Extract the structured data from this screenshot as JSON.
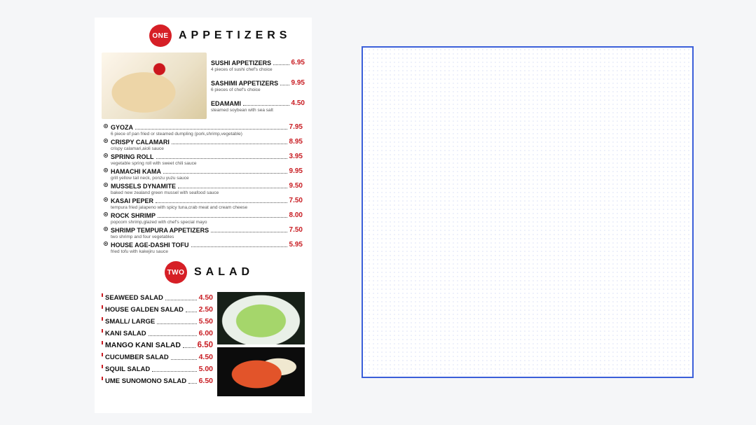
{
  "sections": {
    "appetizers": {
      "badge": "ONE",
      "title": "APPETIZERS",
      "featured": [
        {
          "name": "SUSHI APPETIZERS",
          "price": "6.95",
          "desc": "4 pieces of sushi chef's choice"
        },
        {
          "name": "SASHIMI APPETIZERS",
          "price": "9.95",
          "desc": "6 pieces of chef's choice"
        },
        {
          "name": "EDAMAMI",
          "price": "4.50",
          "desc": "steamed soybean with sea salt"
        }
      ],
      "items": [
        {
          "name": "GYOZA",
          "price": "7.95",
          "desc": "6 piece of pan fried or steamed dumpling (pork,shrimp,vegetable)"
        },
        {
          "name": "CRISPY CALAMARI",
          "price": "8.95",
          "desc": "crispy calamari,aioli sauce"
        },
        {
          "name": "SPRING ROLL",
          "price": "3.95",
          "desc": "vegetable spring roll with sweet chili sauce"
        },
        {
          "name": "HAMACHI KAMA",
          "price": "9.95",
          "desc": "grill yellow tail neck, ponzu yuzu sauce"
        },
        {
          "name": "MUSSELS DYNAMITE",
          "price": "9.50",
          "desc": "baked new zealand green mussel with seafood sauce"
        },
        {
          "name": "KASAI PEPER",
          "price": "7.50",
          "desc": "tempura fried jalapeno with spicy tuna,crab meat and cream cheese"
        },
        {
          "name": "ROCK SHRIMP",
          "price": "8.00",
          "desc": "popcorn shrimp,glazed with chef's special mayo"
        },
        {
          "name": "SHRIMP TEMPURA APPETIZERS",
          "price": "7.50",
          "desc": "two shrimp and four vegetables"
        },
        {
          "name": "HOUSE AGE-DASHI TOFU",
          "price": "5.95",
          "desc": "fried tofu with kakejiru sauce"
        }
      ]
    },
    "salad": {
      "badge": "TWO",
      "title": "SALAD",
      "items": [
        {
          "name": "SEAWEED SALAD",
          "price": "4.50"
        },
        {
          "name": "HOUSE GALDEN SALAD",
          "price": "2.50"
        },
        {
          "name": "SMALL/ LARGE",
          "price": "5.50"
        },
        {
          "name": "KANI SALAD",
          "price": "6.00"
        },
        {
          "name": "MANGO KANI SALAD",
          "price": "6.50"
        },
        {
          "name": "CUCUMBER SALAD",
          "price": "4.50"
        },
        {
          "name": "SQUIL SALAD",
          "price": "5.00"
        },
        {
          "name": "UME SUNOMONO SALAD",
          "price": "6.50"
        }
      ]
    }
  }
}
